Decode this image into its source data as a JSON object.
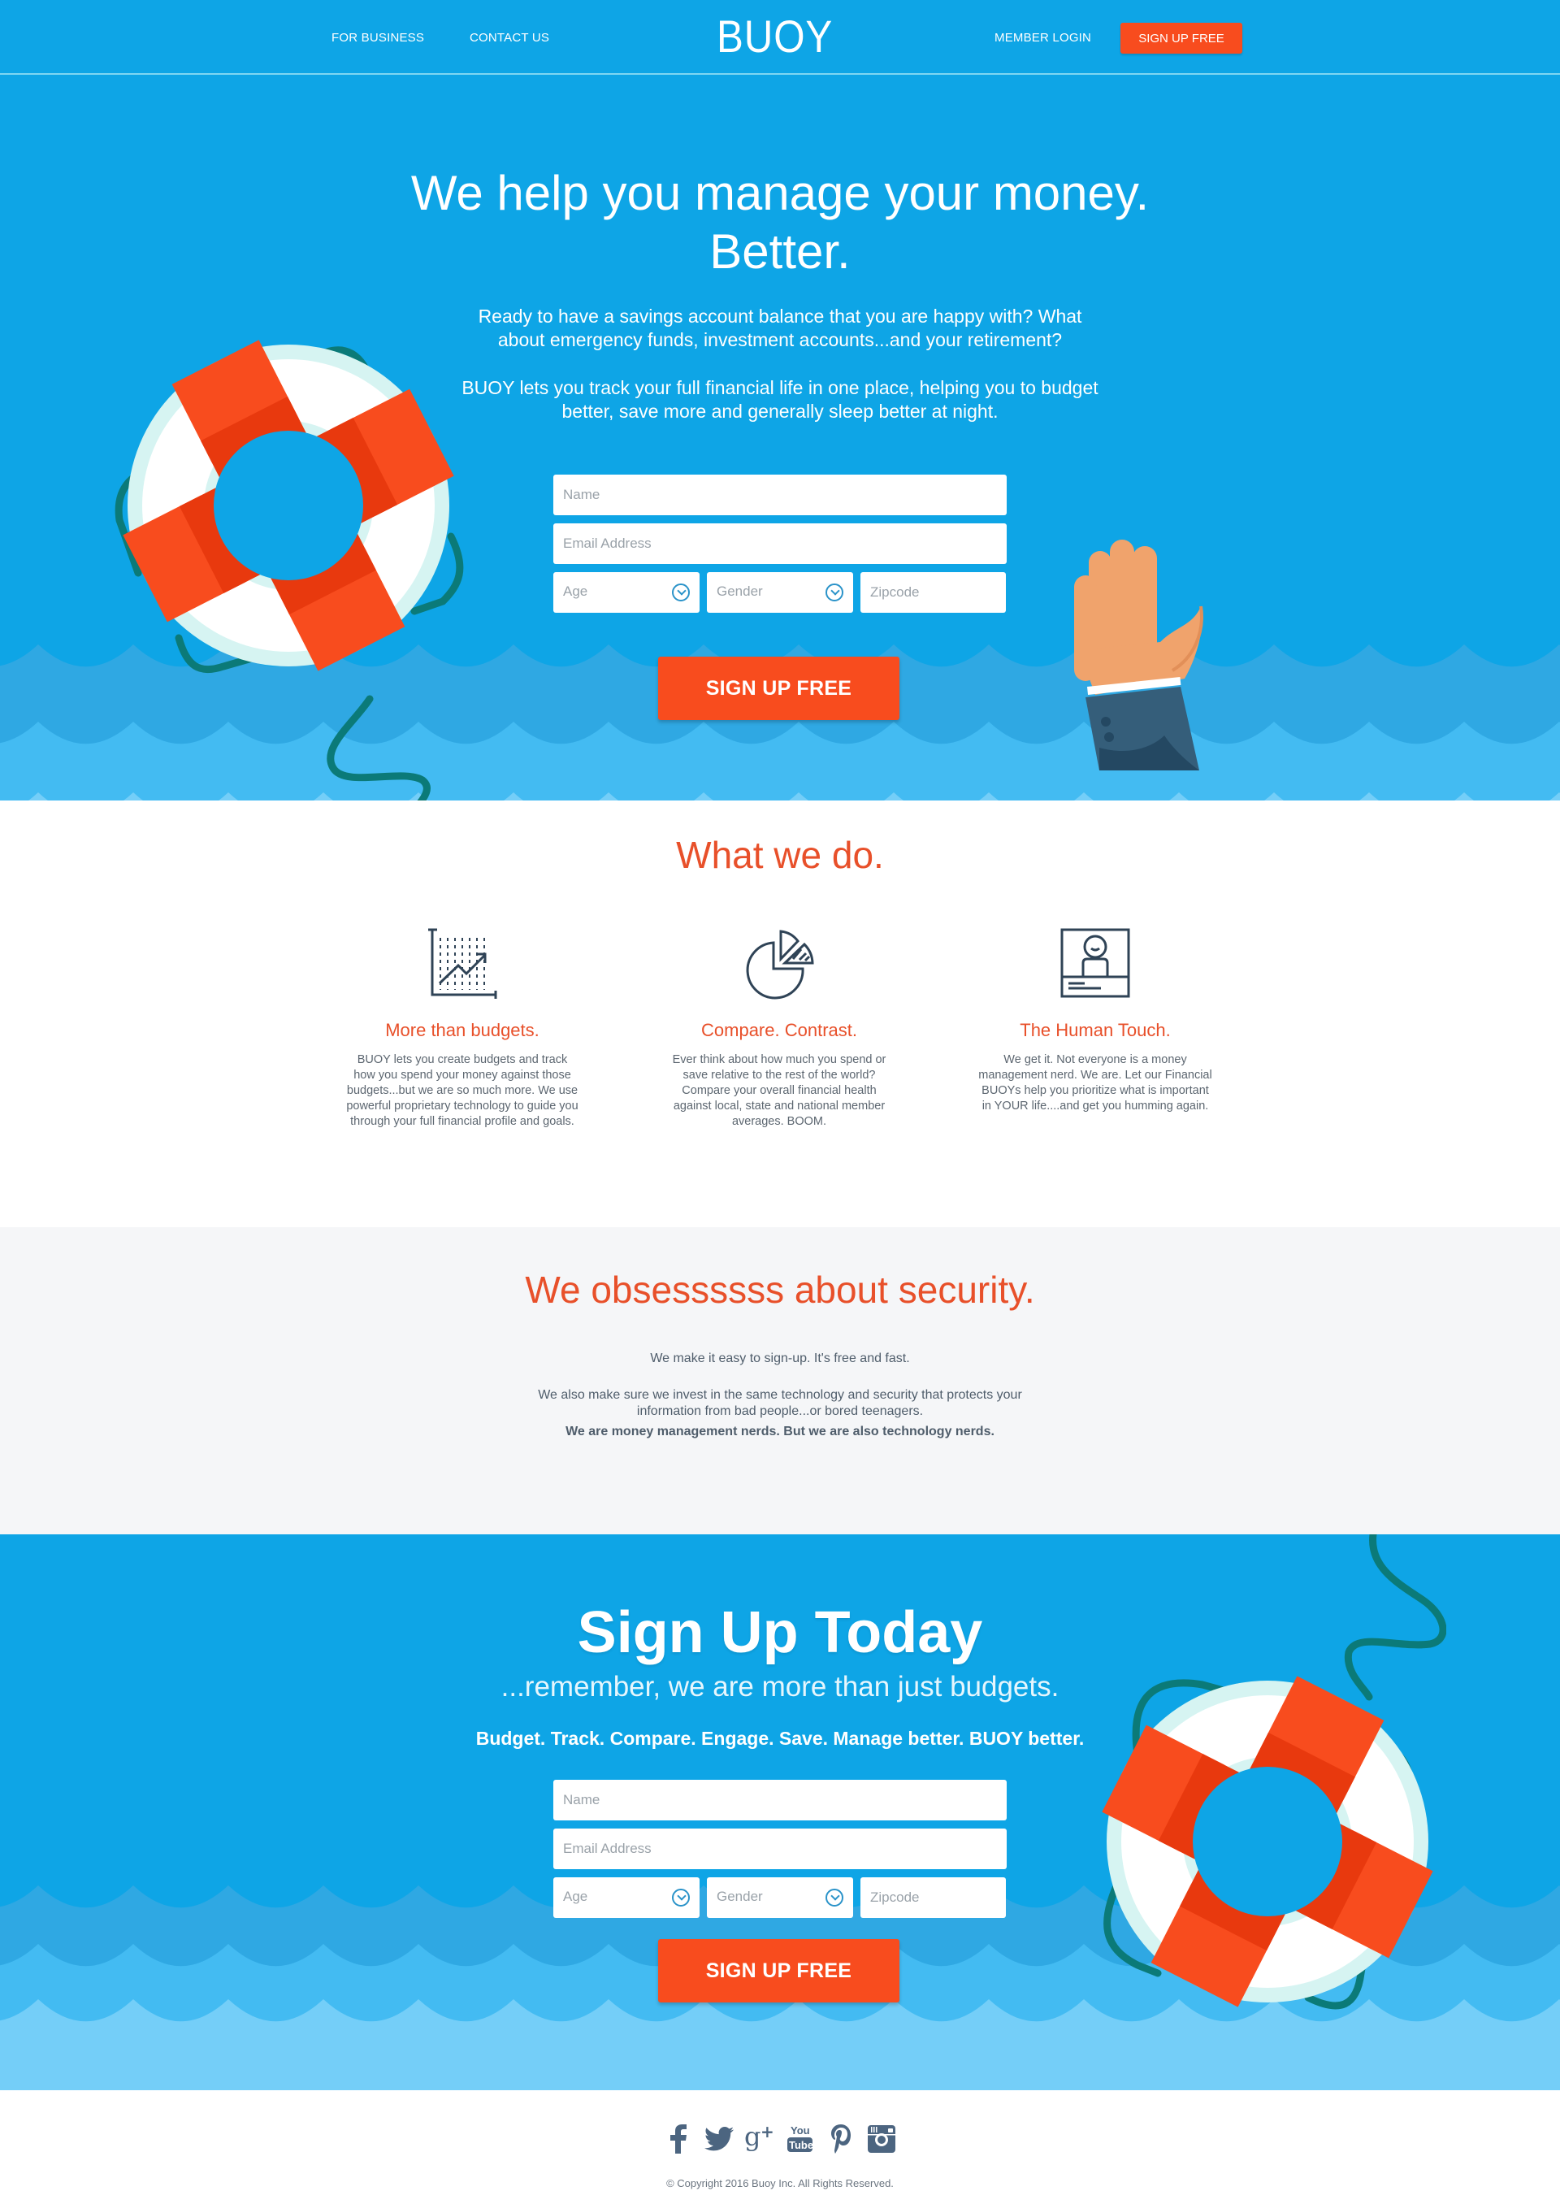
{
  "nav": {
    "for_business": "FOR BUSINESS",
    "contact_us": "CONTACT US",
    "logo": "BUOY",
    "member_login": "MEMBER LOGIN",
    "signup": "SIGN UP FREE"
  },
  "hero": {
    "title_line1": "We help you manage your money.",
    "title_line2": "Better.",
    "para1_line1": "Ready to have a savings account balance that you are happy with? What",
    "para1_line2": "about emergency funds, investment accounts...and your retirement?",
    "para2_line1": "BUOY lets you track your full financial life in one place, helping you to budget",
    "para2_line2": "better, save more and generally sleep better at night."
  },
  "form": {
    "name_placeholder": "Name",
    "email_placeholder": "Email Address",
    "age_label": "Age",
    "gender_label": "Gender",
    "zip_placeholder": "Zipcode",
    "submit": "SIGN UP FREE"
  },
  "what_we_do": {
    "title": "What we do.",
    "features": [
      {
        "icon": "chart-growth-icon",
        "title": "More than budgets.",
        "body": "BUOY lets  you create budgets and track how you spend your money against those budgets...but we are so much more. We use powerful proprietary technology to guide you through your full financial profile and goals."
      },
      {
        "icon": "pie-chart-icon",
        "title": "Compare. Contrast.",
        "body": "Ever think about how much you spend or save relative to the rest of the world? Compare your overall financial health against local, state and national member averages. BOOM."
      },
      {
        "icon": "profile-card-icon",
        "title": "The Human Touch.",
        "body": "We get it. Not everyone is a money management nerd. We are. Let our Financial BUOYs help you prioritize what is important in YOUR life....and get you humming again."
      }
    ]
  },
  "security": {
    "title": "We obsessssss about security.",
    "line1": "We make it easy to sign-up. It's free and fast.",
    "line2a": "We also make sure we invest in the same technology and security that protects your",
    "line2b": "information from bad people...or bored teenagers.",
    "line3": "We are money management nerds. But we are also technology nerds."
  },
  "signup": {
    "title": "Sign Up Today",
    "subtitle": "...remember, we are more than just budgets.",
    "tagline": "Budget. Track. Compare. Engage. Save. Manage better. BUOY better."
  },
  "footer": {
    "social": [
      "facebook-icon",
      "twitter-icon",
      "google-plus-icon",
      "youtube-icon",
      "pinterest-icon",
      "instagram-icon"
    ],
    "youtube_text_top": "You",
    "youtube_text_bottom": "Tube",
    "copyright": "© Copyright 2016 Buoy Inc. All Rights Reserved."
  },
  "colors": {
    "primary_blue": "#0ea5e6",
    "accent_orange": "#f84c1e",
    "heading_orange": "#e8502a",
    "icon_navy": "#2f4356"
  }
}
